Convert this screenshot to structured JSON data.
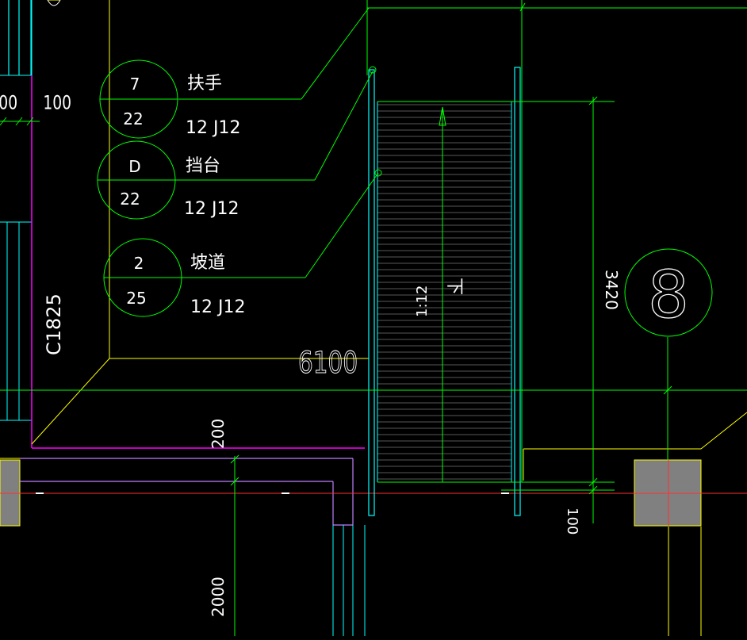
{
  "colors": {
    "background": "#000000",
    "green": "#00ff00",
    "cyan": "#00ffff",
    "yellow": "#ffff00",
    "magenta": "#ff00ff",
    "purple": "#c080ff",
    "red": "#ff3030",
    "white": "#ffffff",
    "gray": "#808080",
    "hatch": "#b0b0b0"
  },
  "callouts": [
    {
      "number": "7",
      "sheet": "22",
      "label": "扶手",
      "ref": "12 J12"
    },
    {
      "number": "D",
      "sheet": "22",
      "label": "挡台",
      "ref": "12 J12"
    },
    {
      "number": "2",
      "sheet": "25",
      "label": "坡道",
      "ref": "12 J12"
    }
  ],
  "section_marker": "8",
  "dimensions": {
    "left_100a": "00",
    "left_100b": "100",
    "window": "C1825",
    "width": "6100",
    "height": "3420",
    "d200": "200",
    "d2000": "2000",
    "d100": "100"
  },
  "ramp": {
    "slope": "1:12",
    "direction": "下"
  }
}
